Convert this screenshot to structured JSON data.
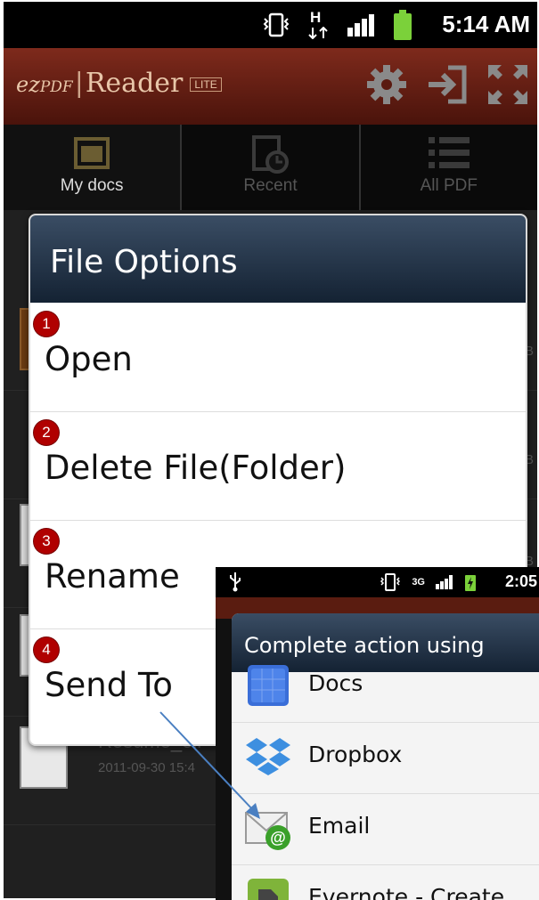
{
  "status_bar": {
    "time": "5:14 AM",
    "network_letter": "H"
  },
  "app_bar": {
    "logo_prefix": "ez",
    "logo_pdf": "PDF",
    "logo_separator": "|",
    "logo_name": "Reader",
    "logo_badge": "LITE"
  },
  "tabs": [
    {
      "label": "My docs",
      "active": true
    },
    {
      "label": "Recent",
      "active": false
    },
    {
      "label": "All PDF",
      "active": false
    }
  ],
  "background_list": {
    "size_suffix": "B",
    "file_name": "Resume_oli",
    "file_date": "2011-09-30 15:4"
  },
  "file_options_dialog": {
    "title": "File Options",
    "options": [
      {
        "number": "1",
        "label": "Open"
      },
      {
        "number": "2",
        "label": "Delete File(Folder)"
      },
      {
        "number": "3",
        "label": "Rename"
      },
      {
        "number": "4",
        "label": "Send To"
      }
    ]
  },
  "inset_screenshot": {
    "time": "2:05",
    "network_label": "3G",
    "chooser_title": "Complete action using",
    "apps": [
      {
        "label": "Docs",
        "icon": "docs-icon"
      },
      {
        "label": "Dropbox",
        "icon": "dropbox-icon"
      },
      {
        "label": "Email",
        "icon": "email-icon"
      },
      {
        "label": "Evernote - Create",
        "icon": "evernote-icon"
      }
    ]
  },
  "colors": {
    "badge_red": "#b00000",
    "header_dark_blue": "#142233",
    "titlebar_red": "#7e2a1c",
    "arrow_blue": "#4a7fc1"
  }
}
